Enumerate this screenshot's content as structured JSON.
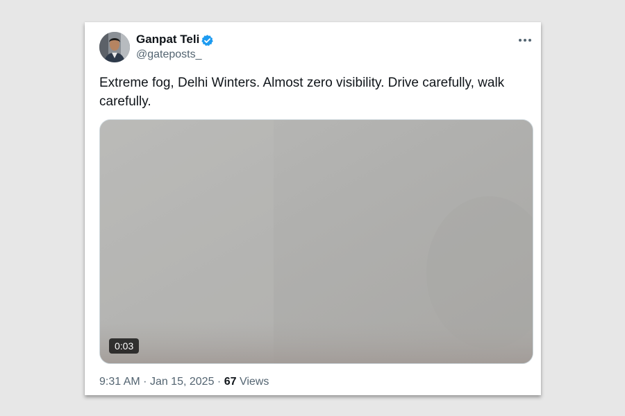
{
  "tweet": {
    "author": {
      "display_name": "Ganpat Teli",
      "handle": "@gateposts_",
      "verified_icon": "verified-badge-icon",
      "verified_color": "#1d9bf0"
    },
    "text": "Extreme fog, Delhi Winters. Almost zero visibility. Drive carefully, walk carefully.",
    "media": {
      "type": "video",
      "duration": "0:03"
    },
    "timestamp": {
      "time": "9:31 AM",
      "separator": "·",
      "date": "Jan 15, 2025"
    },
    "views": {
      "separator": "·",
      "count": "67",
      "label": "Views"
    },
    "more_icon": "more-options-icon"
  },
  "colors": {
    "background": "#e7e7e7",
    "card": "#ffffff",
    "primary_text": "#0f1419",
    "secondary_text": "#536471",
    "accent": "#1d9bf0"
  }
}
